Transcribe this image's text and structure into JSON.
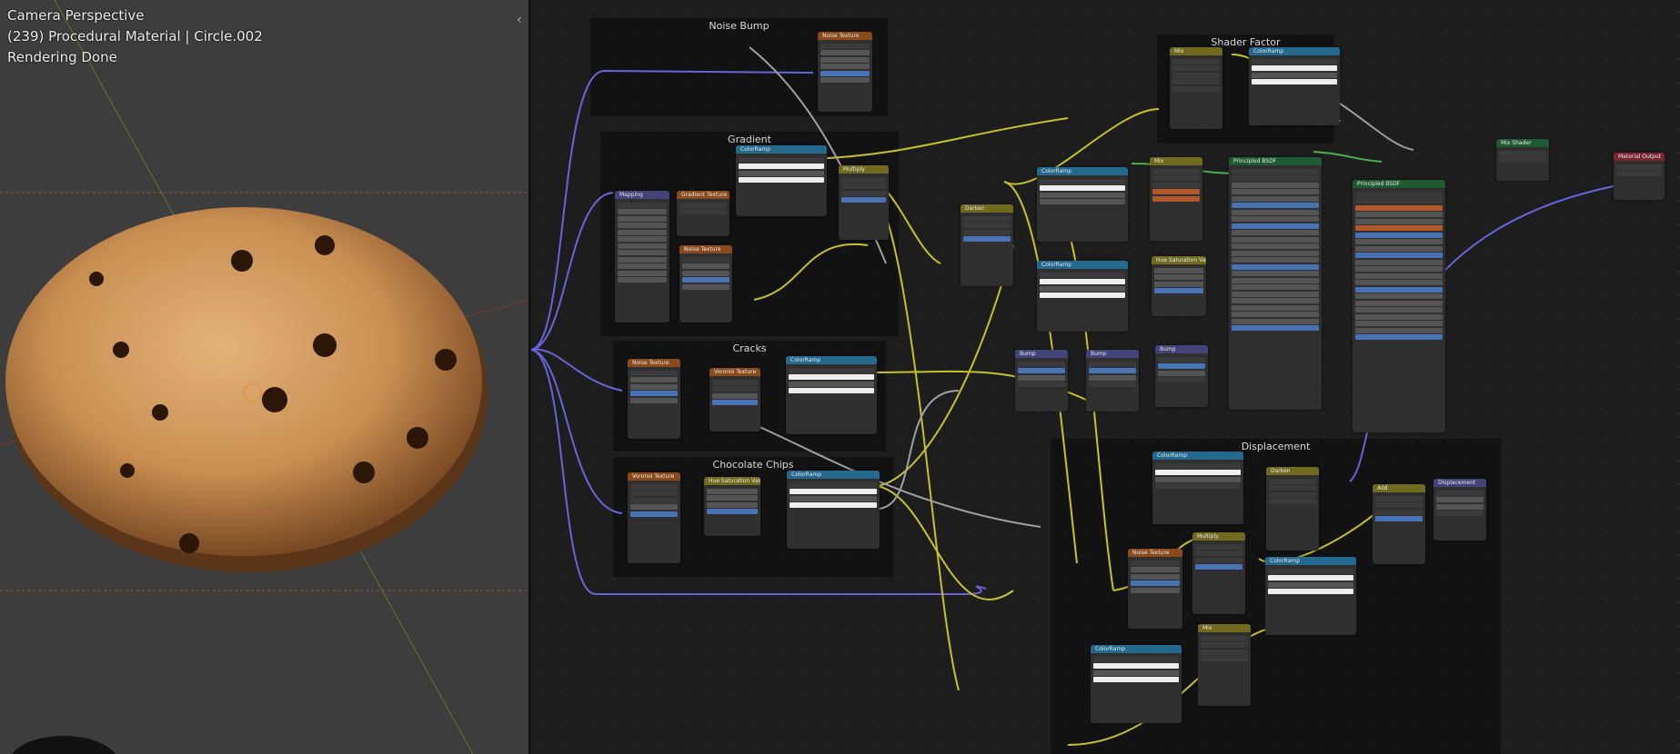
{
  "viewport": {
    "overlay": {
      "view_name": "Camera Perspective",
      "object_info": "(239) Procedural Material | Circle.002",
      "render_status": "Rendering Done"
    }
  },
  "node_editor": {
    "frames": {
      "noise_bump": "Noise Bump",
      "gradient": "Gradient",
      "cracks": "Cracks",
      "chocolate_chips": "Chocolate Chips",
      "shader_factor": "Shader Factor",
      "displacement": "Displacement"
    },
    "nodes": {
      "noise_texture": "Noise Texture",
      "mapping": "Mapping",
      "gradient_texture": "Gradient Texture",
      "color_ramp": "ColorRamp",
      "multiply": "Multiply",
      "darken": "Darken",
      "mix": "Mix",
      "voronoi_texture": "Voronoi Texture",
      "hue_saturation_value": "Hue Saturation Value",
      "bump": "Bump",
      "principled_bsdf": "Principled BSDF",
      "mix_shader": "Mix Shader",
      "material_output": "Material Output",
      "add": "Add",
      "displacement": "Displacement"
    }
  },
  "colors": {
    "wire_vector": "#6b63d9",
    "wire_color": "#c7c229",
    "wire_gray": "#a0a0a0",
    "wire_shader": "#4caf50"
  }
}
